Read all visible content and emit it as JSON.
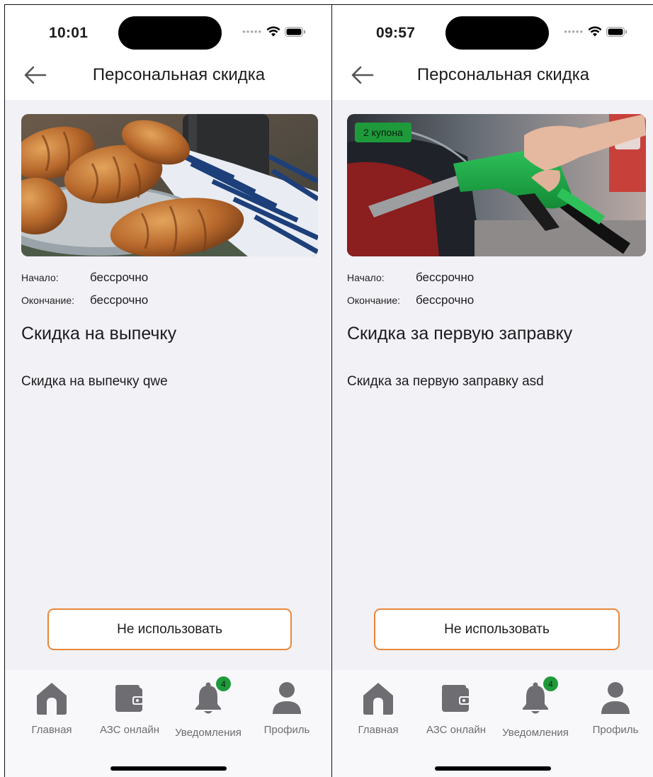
{
  "screens": [
    {
      "status": {
        "time": "10:01"
      },
      "header": {
        "title": "Персональная скидка"
      },
      "banner": {
        "image": "croissants-photo",
        "coupon_badge": ""
      },
      "dates": {
        "start_label": "Начало:",
        "start_value": "бессрочно",
        "end_label": "Окончание:",
        "end_value": "бессрочно"
      },
      "promo": {
        "title": "Скидка на выпечку",
        "description": "Скидка на выпечку qwe"
      },
      "action_button": "Не использовать",
      "tabbar": {
        "tabs": [
          {
            "label": "Главная",
            "icon": "home-icon"
          },
          {
            "label": "АЗС онлайн",
            "icon": "wallet-icon"
          },
          {
            "label": "Уведомления",
            "icon": "bell-icon",
            "badge": "4"
          },
          {
            "label": "Профиль",
            "icon": "person-icon"
          }
        ]
      }
    },
    {
      "status": {
        "time": "09:57"
      },
      "header": {
        "title": "Персональная скидка"
      },
      "banner": {
        "image": "fuel-nozzle-photo",
        "coupon_badge": "2 купона"
      },
      "dates": {
        "start_label": "Начало:",
        "start_value": "бессрочно",
        "end_label": "Окончание:",
        "end_value": "бессрочно"
      },
      "promo": {
        "title": "Скидка за первую заправку",
        "description": "Скидка за первую заправку asd"
      },
      "action_button": "Не использовать",
      "tabbar": {
        "tabs": [
          {
            "label": "Главная",
            "icon": "home-icon"
          },
          {
            "label": "АЗС онлайн",
            "icon": "wallet-icon"
          },
          {
            "label": "Уведомления",
            "icon": "bell-icon",
            "badge": "4"
          },
          {
            "label": "Профиль",
            "icon": "person-icon"
          }
        ]
      }
    }
  ],
  "colors": {
    "accent_orange": "#e8873a",
    "badge_green": "#1e9a3a",
    "tab_icon_gray": "#6d6d72",
    "screen_background": "#f2f1f6"
  }
}
